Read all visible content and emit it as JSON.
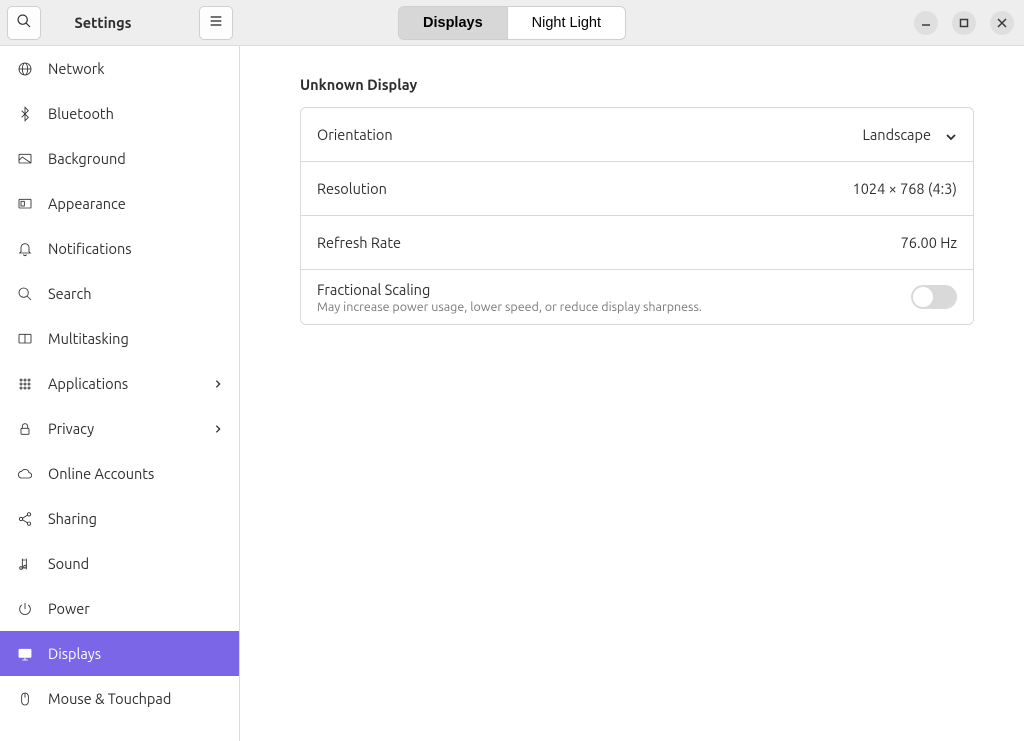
{
  "header": {
    "title": "Settings",
    "tabs": [
      {
        "label": "Displays",
        "active": true
      },
      {
        "label": "Night Light",
        "active": false
      }
    ]
  },
  "sidebar": {
    "items": [
      {
        "label": "Network",
        "icon": "globe-icon",
        "chevron": false,
        "active": false
      },
      {
        "label": "Bluetooth",
        "icon": "bluetooth-icon",
        "chevron": false,
        "active": false
      },
      {
        "label": "Background",
        "icon": "background-icon",
        "chevron": false,
        "active": false
      },
      {
        "label": "Appearance",
        "icon": "appearance-icon",
        "chevron": false,
        "active": false
      },
      {
        "label": "Notifications",
        "icon": "bell-icon",
        "chevron": false,
        "active": false
      },
      {
        "label": "Search",
        "icon": "search-icon",
        "chevron": false,
        "active": false
      },
      {
        "label": "Multitasking",
        "icon": "multitasking-icon",
        "chevron": false,
        "active": false
      },
      {
        "label": "Applications",
        "icon": "grid-icon",
        "chevron": true,
        "active": false
      },
      {
        "label": "Privacy",
        "icon": "lock-icon",
        "chevron": true,
        "active": false
      },
      {
        "label": "Online Accounts",
        "icon": "cloud-icon",
        "chevron": false,
        "active": false
      },
      {
        "label": "Sharing",
        "icon": "share-icon",
        "chevron": false,
        "active": false
      },
      {
        "label": "Sound",
        "icon": "sound-icon",
        "chevron": false,
        "active": false
      },
      {
        "label": "Power",
        "icon": "power-icon",
        "chevron": false,
        "active": false
      },
      {
        "label": "Displays",
        "icon": "display-icon",
        "chevron": false,
        "active": true
      },
      {
        "label": "Mouse & Touchpad",
        "icon": "mouse-icon",
        "chevron": false,
        "active": false
      }
    ]
  },
  "main": {
    "section_title": "Unknown Display",
    "rows": {
      "orientation": {
        "label": "Orientation",
        "value": "Landscape"
      },
      "resolution": {
        "label": "Resolution",
        "value": "1024 × 768 (4:3)"
      },
      "refresh": {
        "label": "Refresh Rate",
        "value": "76.00 Hz"
      },
      "fractional": {
        "label": "Fractional Scaling",
        "sublabel": "May increase power usage, lower speed, or reduce display sharpness.",
        "enabled": false
      }
    }
  }
}
